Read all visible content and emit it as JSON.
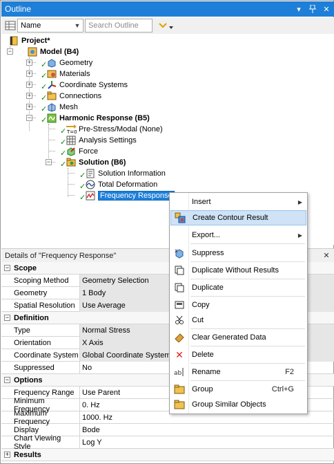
{
  "window": {
    "title": "Outline"
  },
  "toolbar": {
    "filter_select": "Name",
    "search_placeholder": "Search Outline"
  },
  "tree": {
    "project": "Project*",
    "model": "Model (B4)",
    "geometry": "Geometry",
    "materials": "Materials",
    "coord": "Coordinate Systems",
    "connections": "Connections",
    "mesh": "Mesh",
    "harmonic": "Harmonic Response (B5)",
    "prestress": "Pre-Stress/Modal (None)",
    "analysis": "Analysis Settings",
    "force": "Force",
    "solution": "Solution (B6)",
    "solinfo": "Solution Information",
    "totaldef": "Total Deformation",
    "freqresp": "Frequency Response"
  },
  "details": {
    "title": "Details of \"Frequency Response\"",
    "sections": {
      "scope": "Scope",
      "definition": "Definition",
      "options": "Options",
      "results": "Results"
    },
    "rows": {
      "scoping_method": {
        "label": "Scoping Method",
        "value": "Geometry Selection"
      },
      "geometry": {
        "label": "Geometry",
        "value": "1 Body"
      },
      "spatial": {
        "label": "Spatial Resolution",
        "value": "Use Average"
      },
      "type": {
        "label": "Type",
        "value": "Normal Stress"
      },
      "orientation": {
        "label": "Orientation",
        "value": "X Axis"
      },
      "coord": {
        "label": "Coordinate System",
        "value": "Global Coordinate System"
      },
      "suppressed": {
        "label": "Suppressed",
        "value": "No"
      },
      "freq_range": {
        "label": "Frequency Range",
        "value": "Use Parent"
      },
      "min_freq": {
        "label": "Minimum Frequency",
        "value": "0. Hz"
      },
      "max_freq": {
        "label": "Maximum Frequency",
        "value": "1000. Hz"
      },
      "display": {
        "label": "Display",
        "value": "Bode"
      },
      "chart_style": {
        "label": "Chart Viewing Style",
        "value": "Log Y"
      }
    }
  },
  "context_menu": {
    "insert": "Insert",
    "create_contour": "Create Contour Result",
    "export": "Export...",
    "suppress": "Suppress",
    "dup_without": "Duplicate Without Results",
    "duplicate": "Duplicate",
    "copy": "Copy",
    "cut": "Cut",
    "clear": "Clear Generated Data",
    "delete": "Delete",
    "rename": "Rename",
    "rename_shortcut": "F2",
    "group": "Group",
    "group_shortcut": "Ctrl+G",
    "group_similar": "Group Similar Objects"
  },
  "colors": {
    "accent": "#1e7fd8",
    "check": "#0a8a0a",
    "highlight": "#cfe2f6"
  }
}
